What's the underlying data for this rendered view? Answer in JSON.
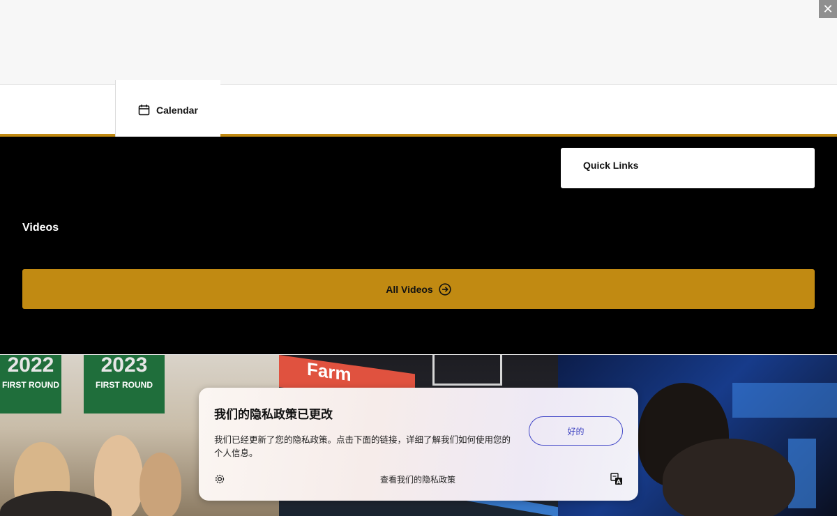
{
  "window": {
    "close_glyph": "✕"
  },
  "nav": {
    "tab_label": "Calendar",
    "tab_icon": "calendar-icon"
  },
  "quick_links": {
    "label": "Quick Links"
  },
  "videos": {
    "heading": "Videos",
    "all_videos_label": "All Videos",
    "all_videos_icon": "arrow-right-circle-icon"
  },
  "photos": {
    "photo1": {
      "banners": [
        {
          "year": "2022",
          "text": "FIRST ROUND"
        },
        {
          "year": "2023",
          "text": "FIRST ROUND"
        }
      ]
    },
    "photo2": {
      "sign_text": "Farm"
    }
  },
  "privacy": {
    "title": "我们的隐私政策已更改",
    "body": "我们已经更新了您的隐私政策。点击下面的链接，详细了解我们如何使用您的个人信息。",
    "ok_label": "好的",
    "policy_link": "查看我们的隐私政策",
    "settings_icon": "gear-icon",
    "translate_icon": "translate-icon"
  },
  "colors": {
    "gold": "#c18a12",
    "black": "#000000",
    "ok_blue": "#3a3fc0"
  }
}
